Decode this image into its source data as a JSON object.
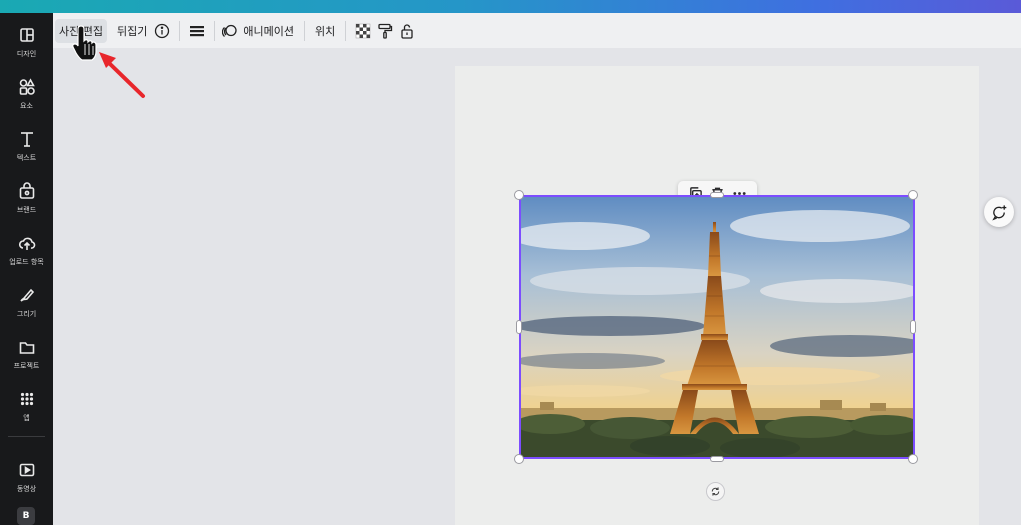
{
  "sidebar": {
    "items": [
      {
        "label": "디자인",
        "icon": "layout-icon"
      },
      {
        "label": "요소",
        "icon": "shapes-icon"
      },
      {
        "label": "텍스트",
        "icon": "text-icon"
      },
      {
        "label": "브랜드",
        "icon": "brand-icon"
      },
      {
        "label": "업로드 항목",
        "icon": "upload-cloud-icon"
      },
      {
        "label": "그리기",
        "icon": "draw-icon"
      },
      {
        "label": "프로젝트",
        "icon": "folder-icon"
      },
      {
        "label": "앱",
        "icon": "apps-grid-icon"
      },
      {
        "label": "동영상",
        "icon": "video-icon"
      }
    ],
    "bottom_badge": "B"
  },
  "toolbar": {
    "edit_photo_label": "사진 편집",
    "flip_label": "뒤집기",
    "animation_label": "애니메이션",
    "position_label": "위치"
  },
  "colors": {
    "selection": "#7c4dff",
    "annotation_arrow": "#e8262b",
    "sidebar_bg": "#18191b"
  }
}
